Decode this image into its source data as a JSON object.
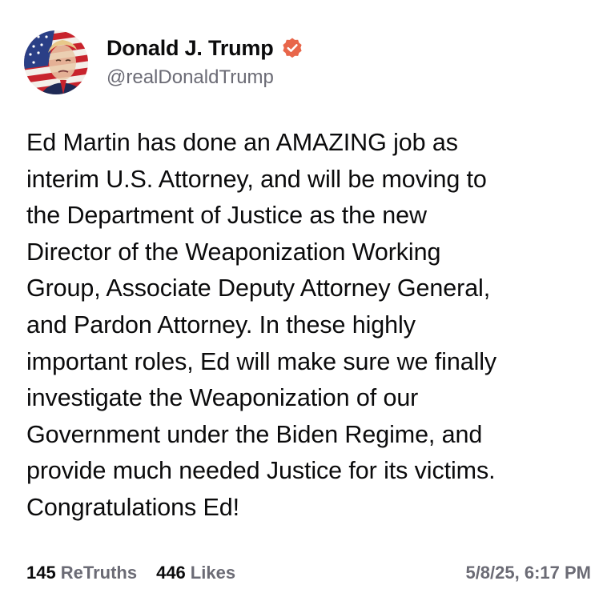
{
  "post": {
    "author": {
      "display_name": "Donald J. Trump",
      "handle": "@realDonaldTrump",
      "verified": true,
      "verified_badge_color": "#e8664a"
    },
    "body": "Ed Martin has done an AMAZING job as\ninterim U.S. Attorney, and will be moving to\nthe Department of Justice as the new\nDirector of the Weaponization Working\nGroup, Associate Deputy Attorney General,\nand Pardon Attorney. In these highly\nimportant roles, Ed will make sure we finally\ninvestigate the Weaponization of our\nGovernment under the Biden Regime, and\nprovide much needed Justice for its victims.\nCongratulations Ed!",
    "stats": {
      "retruths_count": "145",
      "retruths_label": "ReTruths",
      "likes_count": "446",
      "likes_label": "Likes"
    },
    "timestamp": "5/8/25, 6:17 PM"
  },
  "icons": {
    "avatar": "profile-avatar",
    "verified": "verified-badge-icon"
  }
}
